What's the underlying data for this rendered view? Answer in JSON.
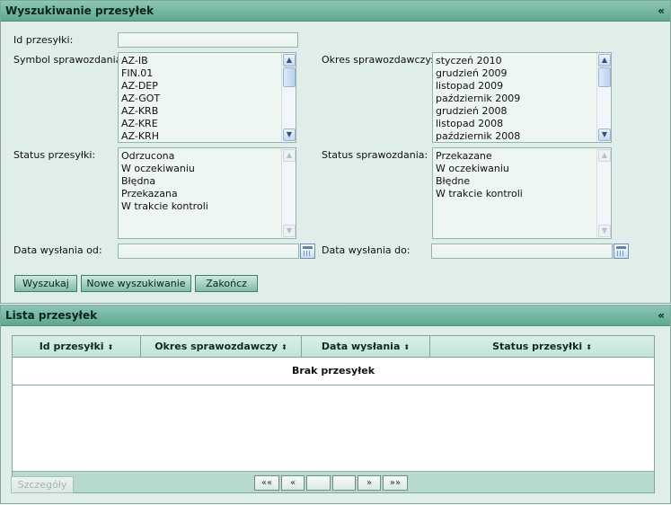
{
  "search_panel": {
    "title": "Wyszukiwanie przesyłek",
    "collapse": "«",
    "labels": {
      "id": "Id przesyłki:",
      "symbol": "Symbol sprawozdania:",
      "period": "Okres sprawozdawczy:",
      "shipment_status": "Status przesyłki:",
      "report_status": "Status sprawozdania:",
      "date_from": "Data wysłania od:",
      "date_to": "Data wysłania do:"
    },
    "values": {
      "id": "",
      "date_from": "",
      "date_to": ""
    },
    "symbol_options": [
      "AZ-IB",
      "FIN.01",
      "AZ-DEP",
      "AZ-GOT",
      "AZ-KRB",
      "AZ-KRE",
      "AZ-KRH"
    ],
    "period_options": [
      "styczeń 2010",
      "grudzień 2009",
      "listopad 2009",
      "październik 2009",
      "grudzień 2008",
      "listopad 2008",
      "październik 2008"
    ],
    "shipment_status_options": [
      "Odrzucona",
      "W oczekiwaniu",
      "Błędna",
      "Przekazana",
      "W trakcie kontroli"
    ],
    "report_status_options": [
      "Przekazane",
      "W oczekiwaniu",
      "Błędne",
      "W trakcie kontroli"
    ],
    "buttons": {
      "search": "Wyszukaj",
      "new_search": "Nowe wyszukiwanie",
      "finish": "Zakończ"
    }
  },
  "list_panel": {
    "title": "Lista przesyłek",
    "collapse": "«",
    "columns": [
      "Id przesyłki",
      "Okres sprawozdawczy",
      "Data wysłania",
      "Status przesyłki"
    ],
    "sort_glyph": "⬍",
    "empty_message": "Brak przesyłek",
    "pager": {
      "first": "««",
      "prev": "«",
      "next": "»",
      "last": "»»"
    },
    "details_button": "Szczegóły"
  },
  "icons": {
    "scroll_up": "▲",
    "scroll_down": "▼",
    "calendar": "calendar-icon"
  },
  "colors": {
    "header": "#6fb3a0",
    "panel_bg": "#dfeee8",
    "border": "#7fa79a"
  }
}
